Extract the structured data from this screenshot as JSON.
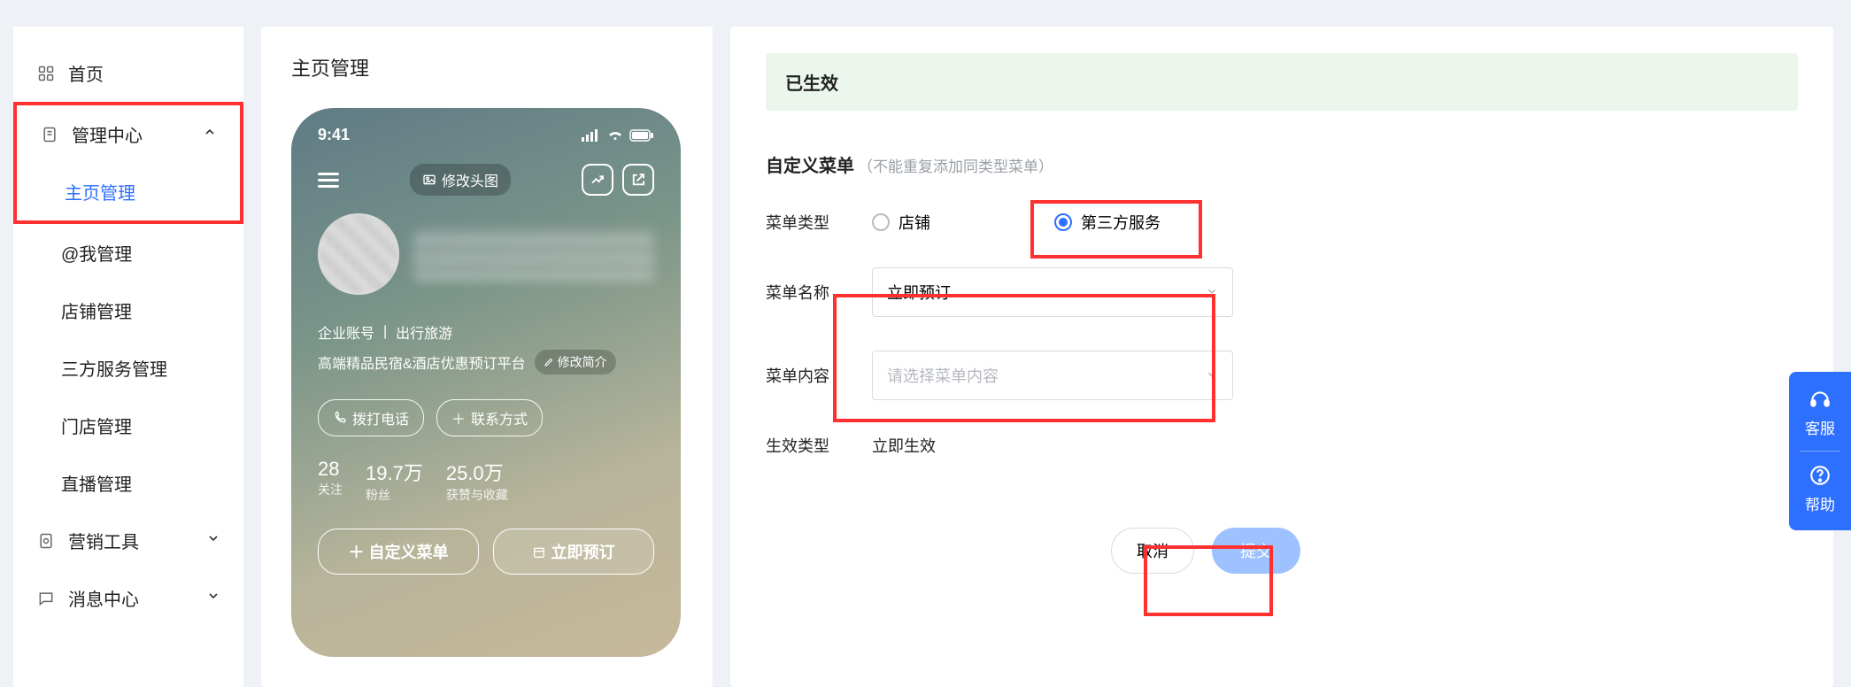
{
  "sidebar": {
    "home": "首页",
    "mgmt_center": "管理中心",
    "home_mgmt": "主页管理",
    "at_me": "@我管理",
    "shop": "店铺管理",
    "third": "三方服务管理",
    "store": "门店管理",
    "live": "直播管理",
    "marketing": "营销工具",
    "msg_center": "消息中心"
  },
  "preview": {
    "title": "主页管理",
    "phone": {
      "time": "9:41",
      "change_cover": "修改头图",
      "account_type": "企业账号",
      "category": "出行旅游",
      "slogan": "高端精品民宿&酒店优惠预订平台",
      "edit_intro": "修改简介",
      "call": "拨打电话",
      "contact": "联系方式",
      "stats": {
        "follow_n": "28",
        "follow_l": "关注",
        "fans_n": "19.7万",
        "fans_l": "粉丝",
        "like_n": "25.0万",
        "like_l": "获赞与收藏"
      },
      "custom_menu_btn": "自定义菜单",
      "book_now_btn": "立即预订"
    }
  },
  "form": {
    "banner": "已生效",
    "section_title": "自定义菜单",
    "section_hint": "（不能重复添加同类型菜单）",
    "menu_type_label": "菜单类型",
    "opt_shop": "店铺",
    "opt_third": "第三方服务",
    "menu_name_label": "菜单名称",
    "menu_name_value": "立即预订",
    "menu_content_label": "菜单内容",
    "menu_content_placeholder": "请选择菜单内容",
    "effect_type_label": "生效类型",
    "effect_type_value": "立即生效",
    "cancel": "取消",
    "submit": "提交"
  },
  "floater": {
    "kefu": "客服",
    "help": "帮助"
  }
}
